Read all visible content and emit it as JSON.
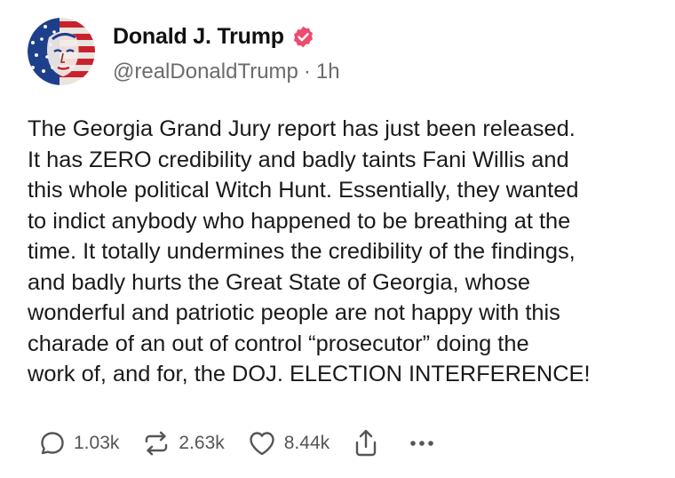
{
  "author": {
    "display_name": "Donald J. Trump",
    "handle": "@realDonaldTrump",
    "separator": "·",
    "time": "1h"
  },
  "post": {
    "lines": [
      "The Georgia Grand Jury report has just been released.",
      "It has ZERO credibility and badly taints Fani Willis and",
      "this whole political Witch Hunt. Essentially, they wanted",
      "to indict anybody who happened to be breathing at the",
      "time. It totally undermines the credibility of the findings,",
      "and badly hurts the Great State of Georgia, whose",
      "wonderful and patriotic people are not happy with this",
      "charade of an out of control “prosecutor” doing the",
      "work of, and for, the DOJ. ELECTION INTERFERENCE!"
    ]
  },
  "actions": {
    "replies": "1.03k",
    "reposts": "2.63k",
    "likes": "8.44k"
  },
  "icons": {
    "verified": "verified-badge-icon",
    "reply": "reply-icon",
    "repost": "repost-icon",
    "like": "heart-icon",
    "share": "share-icon",
    "more": "more-options-icon"
  },
  "colors": {
    "verified_badge": "#ed4b6f",
    "text": "#1a1a1a",
    "muted": "#6b6b6b",
    "icon": "#555555"
  }
}
